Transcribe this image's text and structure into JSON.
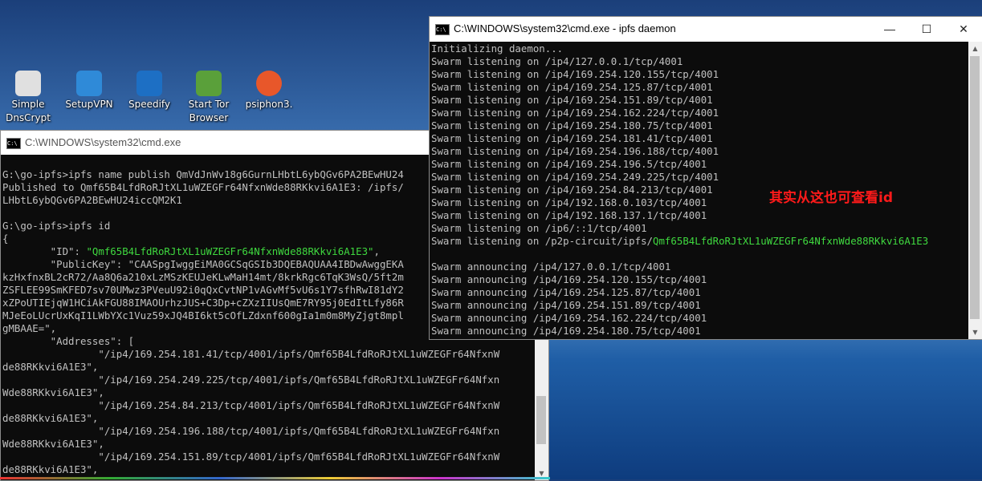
{
  "desktop": {
    "icons": [
      {
        "label": "Simple DnsCrypt",
        "icon": "dnscrypt-icon",
        "color": "#e0e0e0"
      },
      {
        "label": "SetupVPN",
        "icon": "setupvpn-icon",
        "color": "#2f8ad8"
      },
      {
        "label": "Speedify",
        "icon": "speedify-icon",
        "color": "#1d6fc4"
      },
      {
        "label": "Start Tor Browser",
        "icon": "tor-browser-icon",
        "color": "#5aa03a"
      },
      {
        "label": "psiphon3.",
        "icon": "psiphon-icon",
        "color": "#e8572a"
      }
    ]
  },
  "back_window": {
    "title": "C:\\WINDOWS\\system32\\cmd.exe",
    "lines": [
      "",
      "G:\\go-ipfs>ipfs name publish QmVdJnWv18g6GurnLHbtL6ybQGv6PA2BEwHU24",
      "Published to Qmf65B4LfdRoRJtXL1uWZEGFr64NfxnWde88RKkvi6A1E3: /ipfs/",
      "LHbtL6ybQGv6PA2BEwHU24iccQM2K1",
      "",
      "G:\\go-ipfs>ipfs id",
      "{",
      "        \"ID\": \"Qmf65B4LfdRoRJtXL1uWZEGFr64NfxnWde88RKkvi6A1E3\",",
      "        \"PublicKey\": \"CAASpgIwggEiMA0GCSqGSIb3DQEBAQUAA4IBDwAwggEKA",
      "kzHxfnxBL2cR72/Aa8Q6a210xLzMSzKEUJeKLwMaH14mt/8krkRgc6TqK3WsQ/5ft2m",
      "ZSFLEE99SmKFED7sv70UMwz3PVeuU92i0qQxCvtNP1vAGvMf5vU6s1Y7sfhRwI81dY2",
      "xZPoUTIEjqW1HCiAkFGU88IMAOUrhzJUS+C3Dp+cZXzIIUsQmE7RY95j0EdItLfy86R",
      "MJeEoLUcrUxKqI1LWbYXc1Vuz59xJQ4BI6kt5cOfLZdxnf600gIa1m0m8MyZjgt8mpl",
      "gMBAAE=\",",
      "        \"Addresses\": [",
      "                \"/ip4/169.254.181.41/tcp/4001/ipfs/Qmf65B4LfdRoRJtXL1uWZEGFr64NfxnW",
      "de88RKkvi6A1E3\",",
      "                \"/ip4/169.254.249.225/tcp/4001/ipfs/Qmf65B4LfdRoRJtXL1uWZEGFr64Nfxn",
      "Wde88RKkvi6A1E3\",",
      "                \"/ip4/169.254.84.213/tcp/4001/ipfs/Qmf65B4LfdRoRJtXL1uWZEGFr64NfxnW",
      "de88RKkvi6A1E3\",",
      "                \"/ip4/169.254.196.188/tcp/4001/ipfs/Qmf65B4LfdRoRJtXL1uWZEGFr64Nfxn",
      "Wde88RKkvi6A1E3\",",
      "                \"/ip4/169.254.151.89/tcp/4001/ipfs/Qmf65B4LfdRoRJtXL1uWZEGFr64NfxnW",
      "de88RKkvi6A1E3\","
    ],
    "id_value": "Qmf65B4LfdRoRJtXL1uWZEGFr64NfxnWde88RKkvi6A1E3"
  },
  "front_window": {
    "title": "C:\\WINDOWS\\system32\\cmd.exe - ipfs  daemon",
    "minimize": "—",
    "maximize": "☐",
    "close": "✕",
    "lines": [
      "Initializing daemon...",
      "Swarm listening on /ip4/127.0.0.1/tcp/4001",
      "Swarm listening on /ip4/169.254.120.155/tcp/4001",
      "Swarm listening on /ip4/169.254.125.87/tcp/4001",
      "Swarm listening on /ip4/169.254.151.89/tcp/4001",
      "Swarm listening on /ip4/169.254.162.224/tcp/4001",
      "Swarm listening on /ip4/169.254.180.75/tcp/4001",
      "Swarm listening on /ip4/169.254.181.41/tcp/4001",
      "Swarm listening on /ip4/169.254.196.188/tcp/4001",
      "Swarm listening on /ip4/169.254.196.5/tcp/4001",
      "Swarm listening on /ip4/169.254.249.225/tcp/4001",
      "Swarm listening on /ip4/169.254.84.213/tcp/4001",
      "Swarm listening on /ip4/192.168.0.103/tcp/4001",
      "Swarm listening on /ip4/192.168.137.1/tcp/4001",
      "Swarm listening on /ip6/::1/tcp/4001",
      "Swarm listening on /p2p-circuit/ipfs/",
      "",
      "Swarm announcing /ip4/127.0.0.1/tcp/4001",
      "Swarm announcing /ip4/169.254.120.155/tcp/4001",
      "Swarm announcing /ip4/169.254.125.87/tcp/4001",
      "Swarm announcing /ip4/169.254.151.89/tcp/4001",
      "Swarm announcing /ip4/169.254.162.224/tcp/4001",
      "Swarm announcing /ip4/169.254.180.75/tcp/4001"
    ],
    "circuit_id": "Qmf65B4LfdRoRJtXL1uWZEGFr64NfxnWde88RKkvi6A1E3"
  },
  "annotation": "其实从这也可查看id",
  "colors": {
    "console_bg": "#0c0c0c",
    "console_text": "#c0c0c0",
    "highlight": "#3fd93f",
    "annotation": "#ff1a1a"
  }
}
